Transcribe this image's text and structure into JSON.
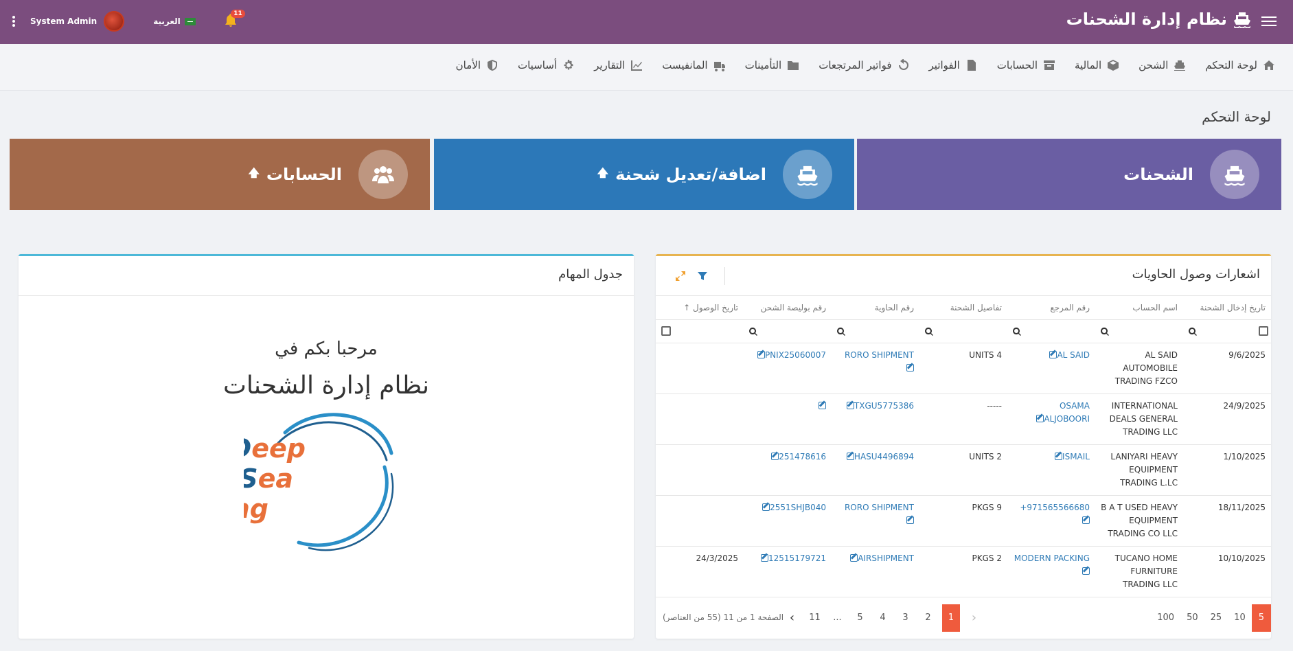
{
  "app": {
    "title": "نظام إدارة الشحنات",
    "user_name": "System Admin",
    "language": "العربية",
    "notifications_count": "11"
  },
  "nav": {
    "items": [
      {
        "label": "لوحة التحكم",
        "icon": "home-icon"
      },
      {
        "label": "الشحن",
        "icon": "ship-icon"
      },
      {
        "label": "المالية",
        "icon": "box-icon"
      },
      {
        "label": "الحسابات",
        "icon": "archive-icon"
      },
      {
        "label": "الفواتير",
        "icon": "file-icon"
      },
      {
        "label": "فواتير المرتجعات",
        "icon": "undo-icon"
      },
      {
        "label": "التأمينات",
        "icon": "folder-icon"
      },
      {
        "label": "المانفيست",
        "icon": "truck-icon"
      },
      {
        "label": "التقارير",
        "icon": "chart-icon"
      },
      {
        "label": "أساسيات",
        "icon": "gear-icon"
      },
      {
        "label": "الأمان",
        "icon": "shield-icon"
      }
    ]
  },
  "page": {
    "title": "لوحة التحكم"
  },
  "tiles": {
    "shipments": "الشحنات",
    "add_edit": "اضافة/تعديل شحنة",
    "accounts": "الحسابات",
    "arrow": "🡅"
  },
  "notifications_panel": {
    "title": "اشعارات وصول الحاويات",
    "columns": [
      "تاريخ إدخال الشحنة",
      "اسم الحساب",
      "رقم المرجع",
      "تفاصيل الشحنة",
      "رقم الحاوية",
      "رقم بوليصة الشحن",
      "تاريخ الوصول"
    ],
    "sort_indicator": "↑",
    "rows": [
      {
        "date": "9/6/2025",
        "account": "AL SAID AUTOMOBILE TRADING FZCO",
        "ref": "AL SAID",
        "details": "UNITS 4",
        "container": "RORO SHIPMENT",
        "bl": "PNIX25060007",
        "arrival": ""
      },
      {
        "date": "24/9/2025",
        "account": "INTERNATIONAL DEALS GENERAL TRADING LLC",
        "ref": "OSAMA ALJOBOORI",
        "details": "-----",
        "container": "TXGU5775386",
        "bl": "",
        "arrival": ""
      },
      {
        "date": "1/10/2025",
        "account": "LANIYARI HEAVY EQUIPMENT TRADING L.LC",
        "ref": "ISMAIL",
        "details": "UNITS 2",
        "container": "HASU4496894",
        "bl": "251478616",
        "arrival": ""
      },
      {
        "date": "18/11/2025",
        "account": "B A T USED HEAVY EQUIPMENT TRADING CO LLC",
        "ref": "+971565566680",
        "details": "PKGS 9",
        "container": "RORO SHIPMENT",
        "bl": "2551SHJB040",
        "arrival": ""
      },
      {
        "date": "10/10/2025",
        "account": "TUCANO HOME FURNITURE TRADING LLC",
        "ref": "MODERN PACKING",
        "details": "PKGS 2",
        "container": "AIRSHIPMENT",
        "bl": "12515179721",
        "arrival": "24/3/2025"
      }
    ],
    "pager": {
      "info": "الصفحة 1 من 11 (55 من العناصر)",
      "pages": [
        "11",
        "...",
        "5",
        "4",
        "3",
        "2",
        "1"
      ],
      "active_page": "1",
      "page_sizes": [
        "100",
        "50",
        "25",
        "10",
        "5"
      ],
      "active_size": "5"
    }
  },
  "tasks_panel": {
    "title": "جدول المهام",
    "welcome_line1": "مرحبا بكم في",
    "welcome_line2": "نظام إدارة الشحنات",
    "logo_words": [
      "Deep",
      "Sea",
      "Shipping"
    ]
  },
  "colors": {
    "topbar": "#7b4d7e",
    "tile_shipments": "#6a5ea3",
    "tile_add": "#2c78b8",
    "tile_accounts": "#a3694a",
    "accent_orange": "#ef5b3d",
    "link_blue": "#2f7bb6"
  }
}
